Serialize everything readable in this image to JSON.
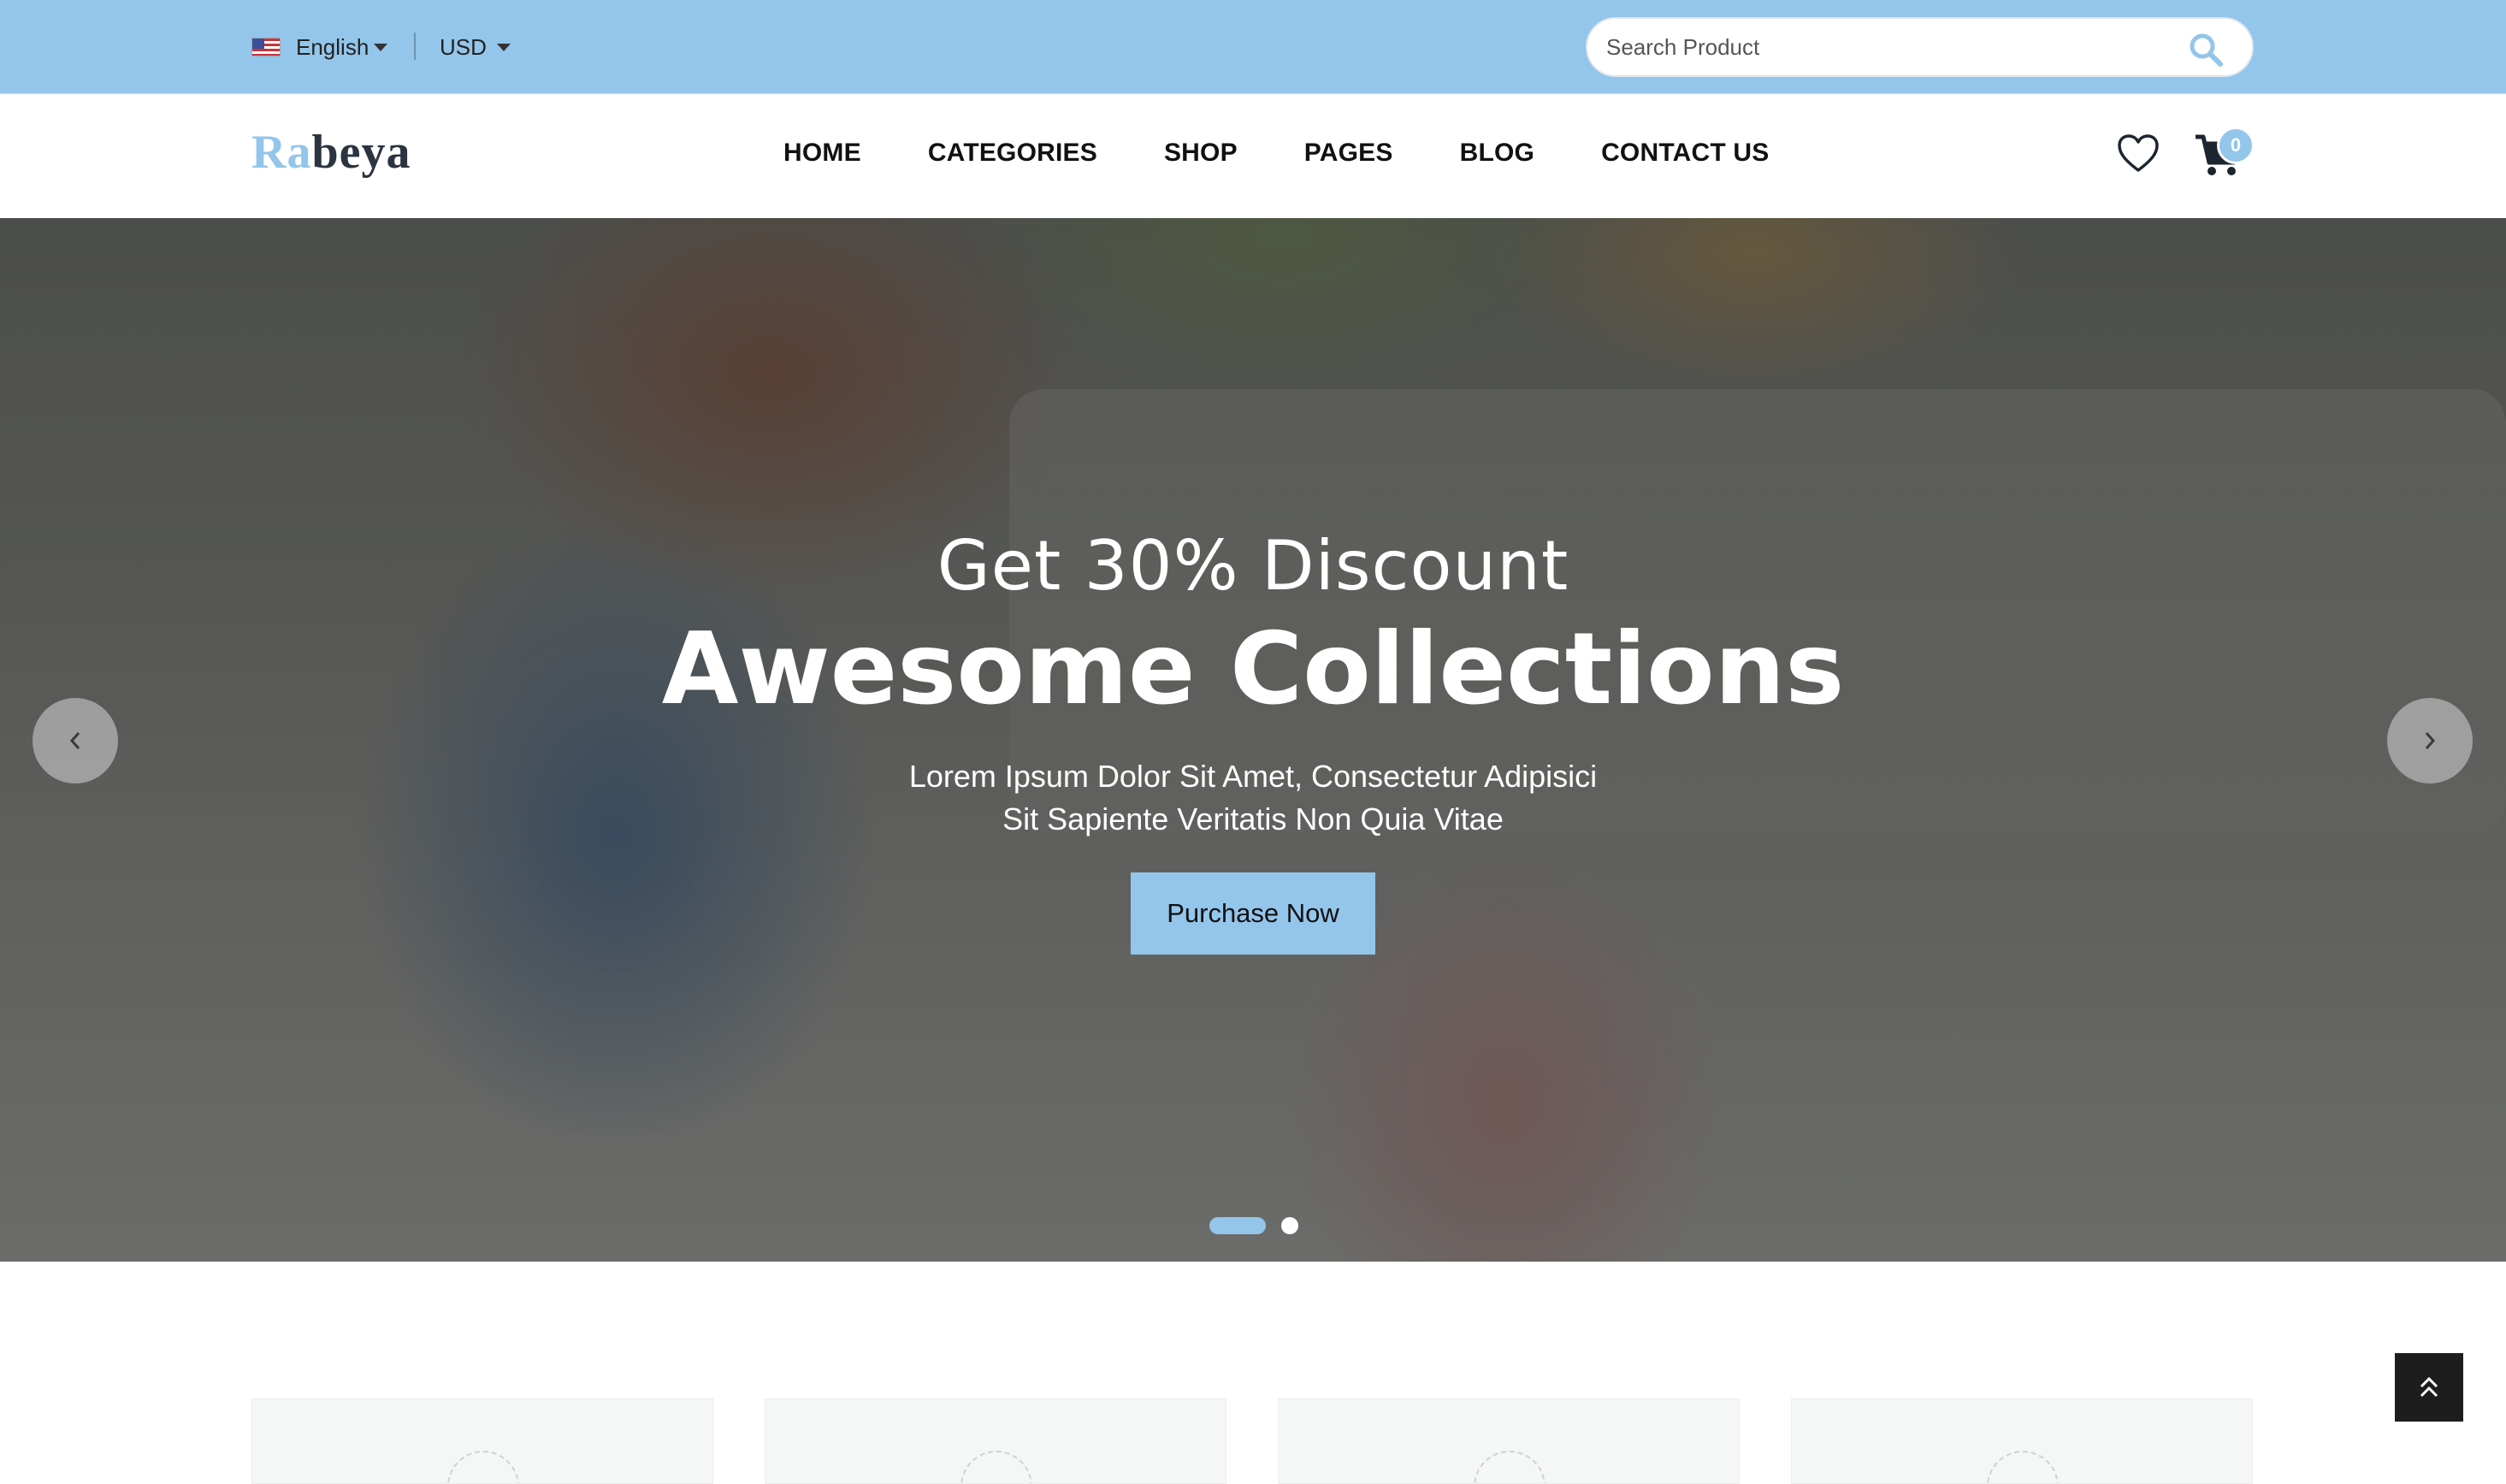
{
  "topbar": {
    "language": "English",
    "currency": "USD",
    "search_placeholder": "Search Product"
  },
  "brand": {
    "logo_part1": "Ra",
    "logo_part2": "beya",
    "accent_color": "#94c5ea"
  },
  "nav": {
    "items": [
      "HOME",
      "CATEGORIES",
      "SHOP",
      "PAGES",
      "BLOG",
      "CONTACT US"
    ]
  },
  "cart": {
    "count": "0"
  },
  "hero": {
    "pre_title": "Get 30% Discount",
    "title": "Awesome Collections",
    "desc_line1": "Lorem Ipsum Dolor Sit Amet, Consectetur Adipisici",
    "desc_line2": "Sit Sapiente Veritatis Non Quia Vitae",
    "button_label": "Purchase Now",
    "slides_total": 2,
    "active_slide": 1
  },
  "icons": {
    "language_flag": "us-flag-icon",
    "search": "search-icon",
    "wishlist": "heart-icon",
    "cart": "cart-icon",
    "prev": "chevron-left-icon",
    "next": "chevron-right-icon",
    "back_to_top": "double-chevron-up-icon"
  }
}
